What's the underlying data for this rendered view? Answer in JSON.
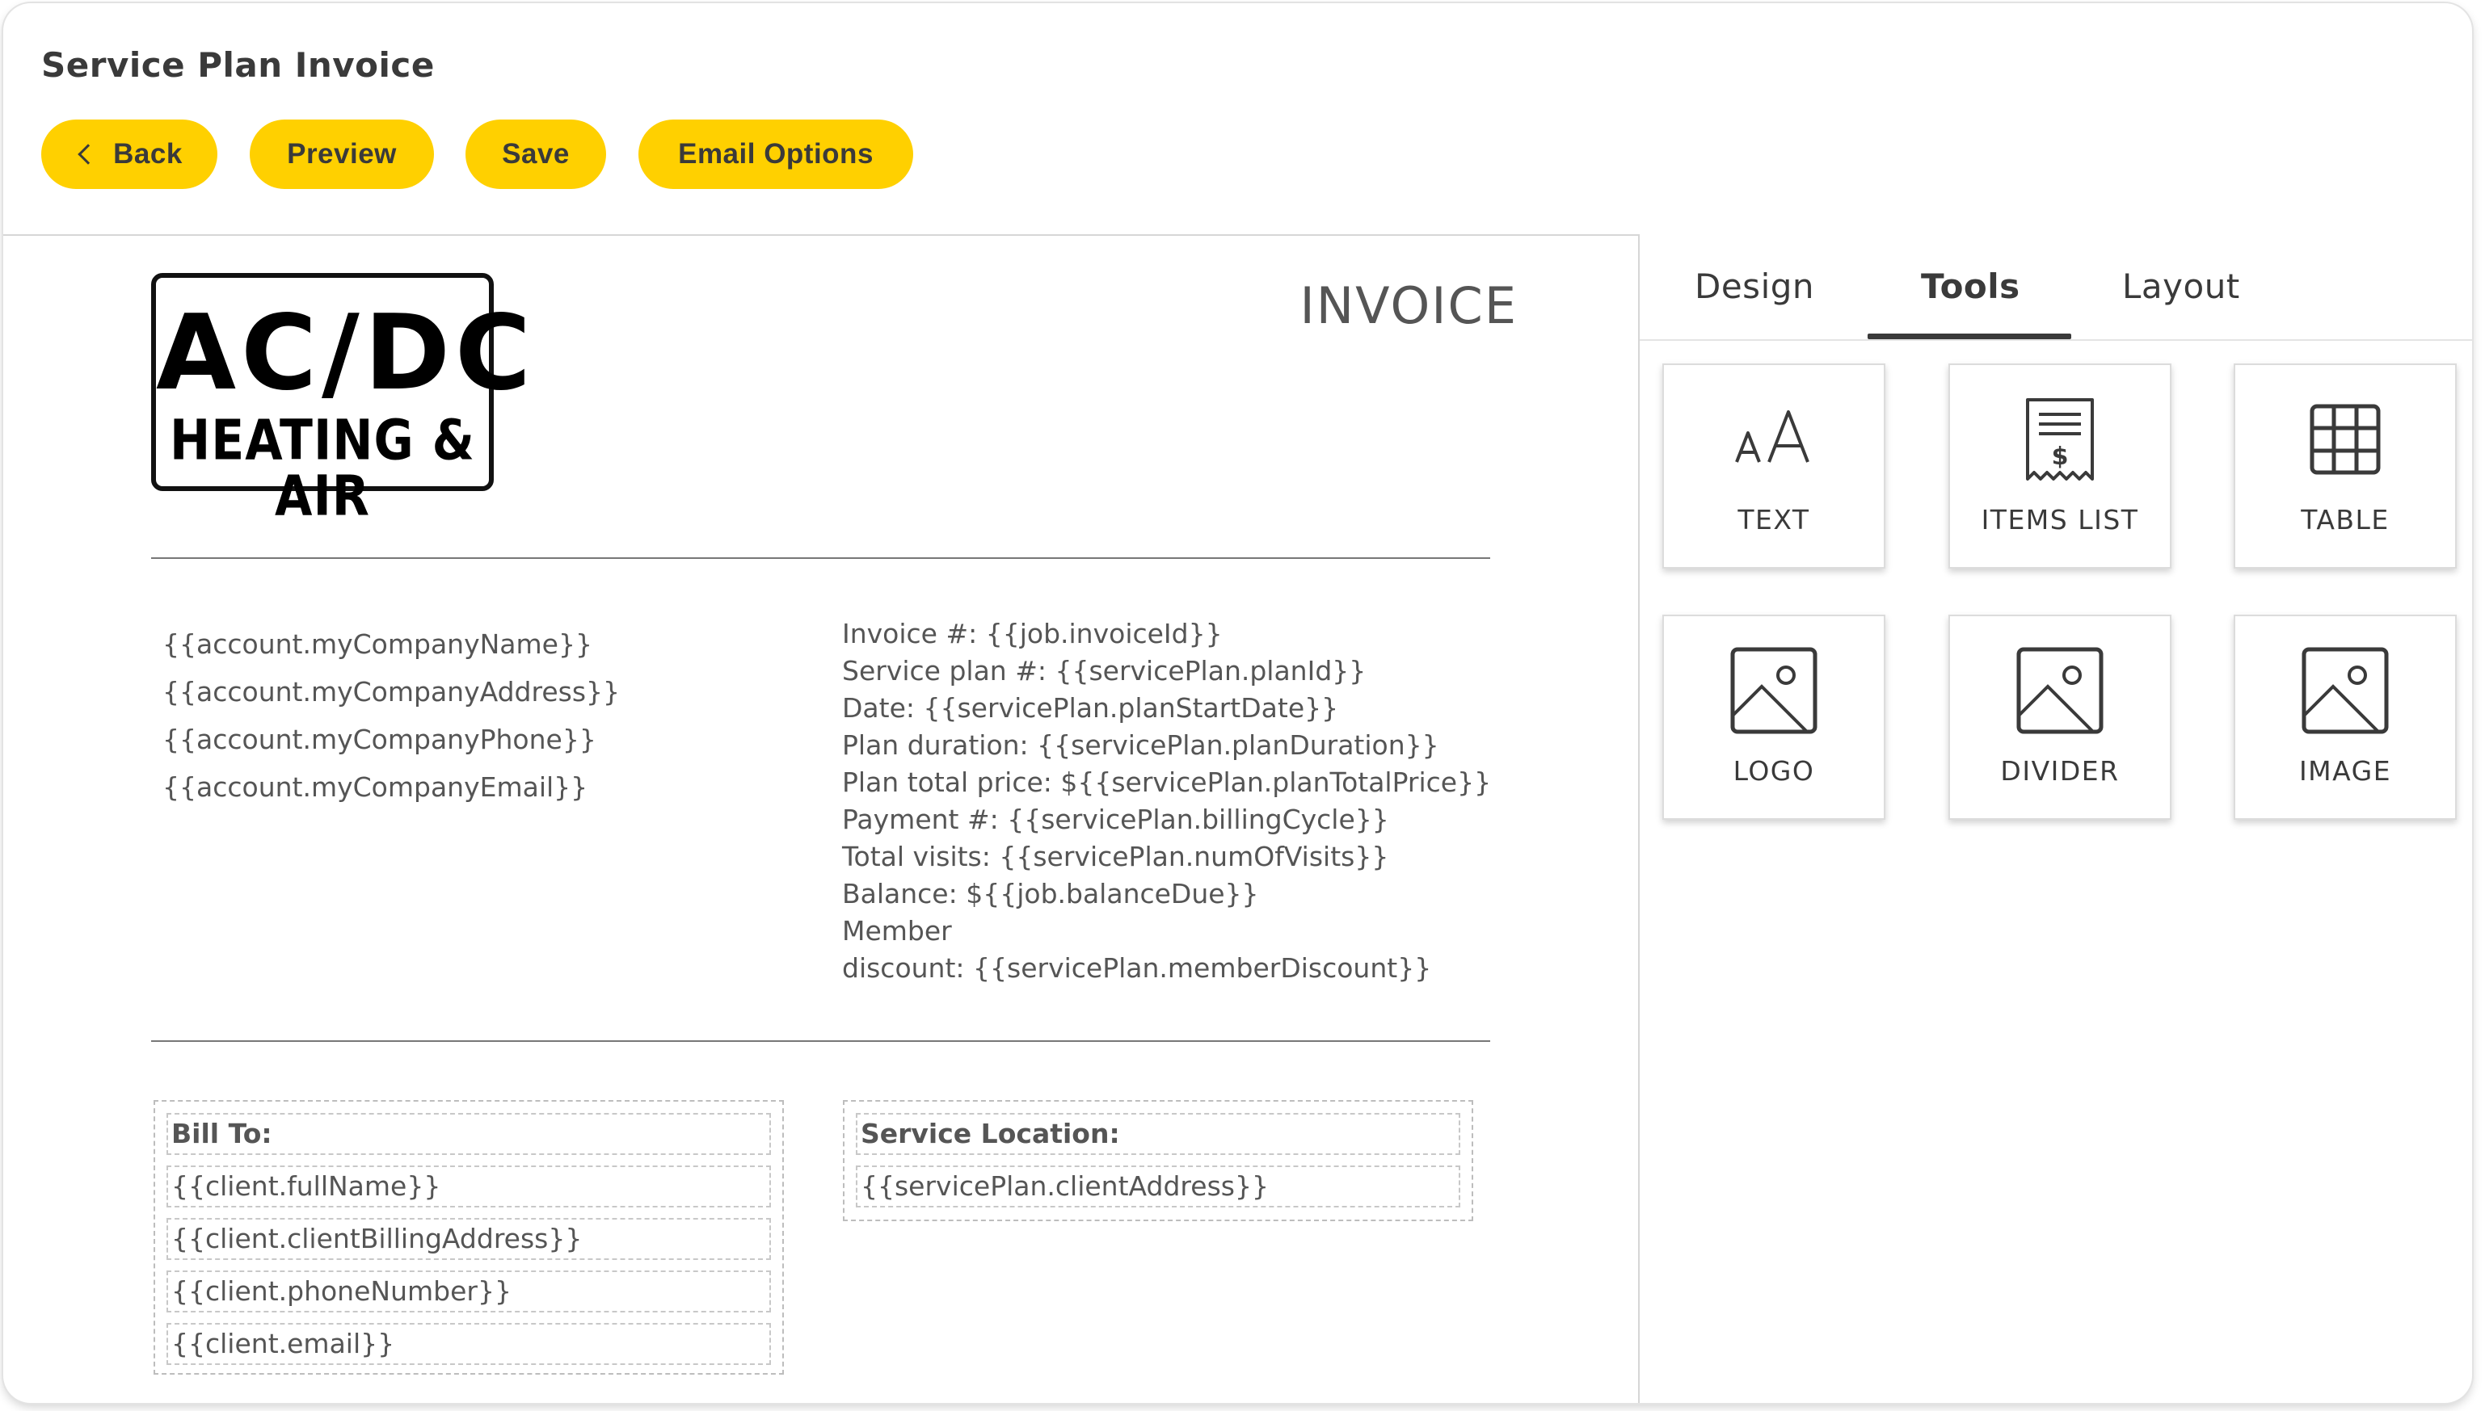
{
  "header": {
    "title": "Service Plan Invoice",
    "buttons": {
      "back": "Back",
      "preview": "Preview",
      "save": "Save",
      "email_options": "Email Options"
    }
  },
  "invoice": {
    "logo": {
      "line1": "AC/DC",
      "line2": "HEATING & AIR"
    },
    "heading": "INVOICE",
    "company_lines": [
      "{{account.myCompanyName}}",
      "{{account.myCompanyAddress}}",
      "{{account.myCompanyPhone}}",
      "{{account.myCompanyEmail}}"
    ],
    "details_lines": [
      "Invoice #: {{job.invoiceId}}",
      "Service plan #: {{servicePlan.planId}}",
      "Date: {{servicePlan.planStartDate}}",
      "Plan duration: {{servicePlan.planDuration}}",
      "Plan total price: ${{servicePlan.planTotalPrice}}",
      "Payment #: {{servicePlan.billingCycle}}",
      "Total visits: {{servicePlan.numOfVisits}}",
      "Balance: ${{job.balanceDue}}",
      "Member",
      "discount: {{servicePlan.memberDiscount}}"
    ],
    "bill_to": {
      "label": "Bill To:",
      "fields": [
        "{{client.fullName}}",
        "{{client.clientBillingAddress}}",
        "{{client.phoneNumber}}",
        "{{client.email}}"
      ]
    },
    "service_location": {
      "label": "Service Location:",
      "fields": [
        "{{servicePlan.clientAddress}}"
      ]
    }
  },
  "panel": {
    "tabs": [
      {
        "label": "Design",
        "active": false
      },
      {
        "label": "Tools",
        "active": true
      },
      {
        "label": "Layout",
        "active": false
      }
    ],
    "tools": [
      {
        "label": "TEXT",
        "icon": "text-size-icon"
      },
      {
        "label": "ITEMS LIST",
        "icon": "receipt-icon"
      },
      {
        "label": "TABLE",
        "icon": "table-grid-icon"
      },
      {
        "label": "LOGO",
        "icon": "image-icon"
      },
      {
        "label": "DIVIDER",
        "icon": "image-icon"
      },
      {
        "label": "IMAGE",
        "icon": "image-icon"
      }
    ]
  },
  "colors": {
    "accent": "#FFD000",
    "text": "#3a3a3a",
    "muted": "#555555"
  }
}
